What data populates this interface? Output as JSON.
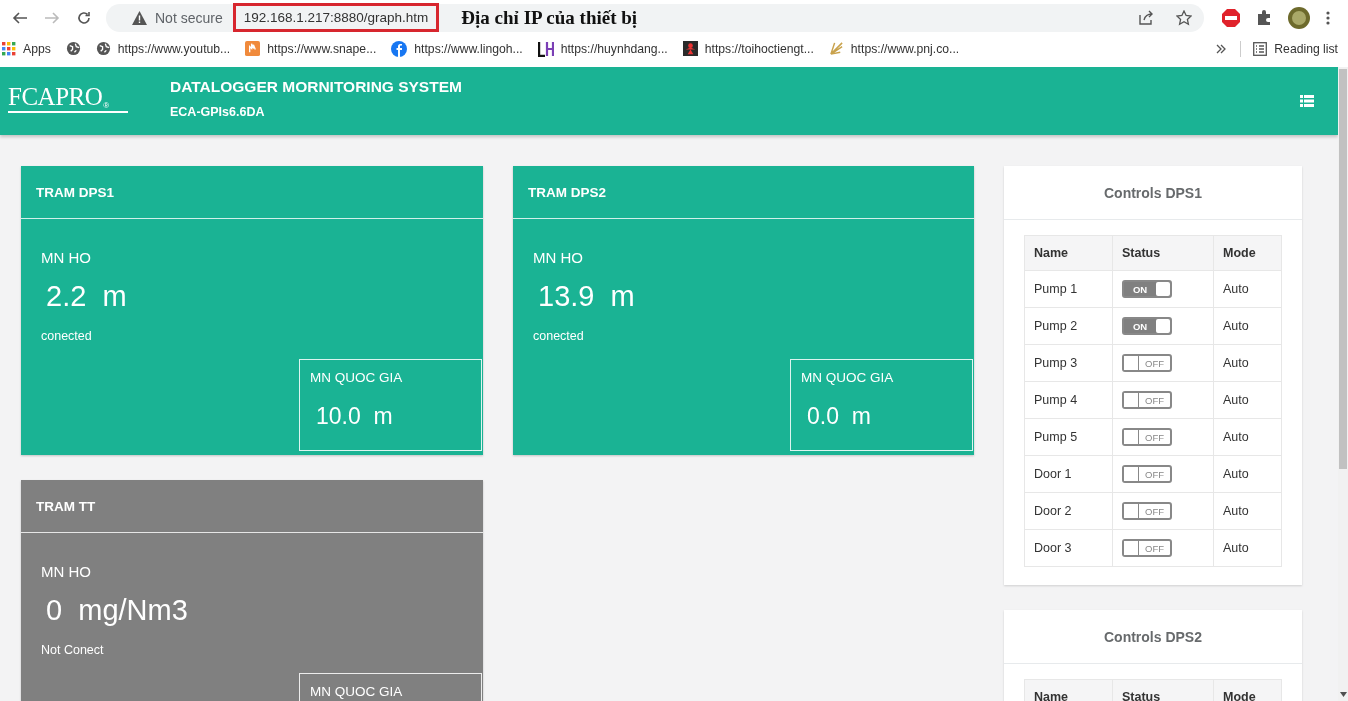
{
  "browser": {
    "not_secure": "Not secure",
    "url": "192.168.1.217:8880/graph.htm",
    "annotation": "Địa chỉ IP của thiết bị",
    "bookmarks": [
      {
        "kind": "apps",
        "label": "Apps"
      },
      {
        "kind": "globe"
      },
      {
        "kind": "globe",
        "label": "https://www.youtub..."
      },
      {
        "kind": "orange",
        "label": "https://www.snape..."
      },
      {
        "kind": "blue",
        "label": "https://www.lingoh..."
      },
      {
        "kind": "lh",
        "label": "https://huynhdang..."
      },
      {
        "kind": "dark",
        "label": "https://toihoctiengt..."
      },
      {
        "kind": "fan",
        "label": "https://www.pnj.co..."
      }
    ],
    "reading_list": "Reading list"
  },
  "header": {
    "logo": "FCAPRO",
    "logo_mark": "®",
    "title": "DATALOGGER MORNITORING SYSTEM",
    "subtitle": "ECA-GPIs6.6DA"
  },
  "stations": [
    {
      "title": "TRAM DPS1",
      "connected": true,
      "label": "MN HO",
      "value": "2.2  m",
      "status": "conected",
      "sub_label": "MN QUOC GIA",
      "sub_value": "10.0  m"
    },
    {
      "title": "TRAM DPS2",
      "connected": true,
      "label": "MN HO",
      "value": "13.9  m",
      "status": "conected",
      "sub_label": "MN QUOC GIA",
      "sub_value": "0.0  m"
    },
    {
      "title": "TRAM TT",
      "connected": false,
      "label": "MN HO",
      "value": "0  mg/Nm3",
      "status": "Not Conect",
      "sub_label": "MN QUOC GIA"
    }
  ],
  "controls": [
    {
      "title": "Controls DPS1",
      "columns": [
        "Name",
        "Status",
        "Mode"
      ],
      "rows": [
        {
          "name": "Pump 1",
          "on": true,
          "switch": "ON",
          "mode": "Auto"
        },
        {
          "name": "Pump 2",
          "on": true,
          "switch": "ON",
          "mode": "Auto"
        },
        {
          "name": "Pump 3",
          "on": false,
          "switch": "OFF",
          "mode": "Auto"
        },
        {
          "name": "Pump 4",
          "on": false,
          "switch": "OFF",
          "mode": "Auto"
        },
        {
          "name": "Pump 5",
          "on": false,
          "switch": "OFF",
          "mode": "Auto"
        },
        {
          "name": "Door 1",
          "on": false,
          "switch": "OFF",
          "mode": "Auto"
        },
        {
          "name": "Door 2",
          "on": false,
          "switch": "OFF",
          "mode": "Auto"
        },
        {
          "name": "Door 3",
          "on": false,
          "switch": "OFF",
          "mode": "Auto"
        }
      ]
    },
    {
      "title": "Controls DPS2",
      "columns": [
        "Name",
        "Status",
        "Mode"
      ]
    }
  ]
}
